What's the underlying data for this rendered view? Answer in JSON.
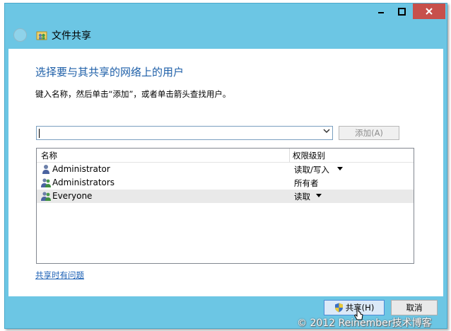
{
  "window": {
    "title": "文件共享",
    "minimize_glyph": "—",
    "maximize_glyph": "▫",
    "close_glyph": "✕"
  },
  "main": {
    "heading": "选择要与其共享的网络上的用户",
    "instruction": "键入名称，然后单击“添加”，或者单击箭头查找用户。",
    "name_input_value": "",
    "add_button": "添加(A)"
  },
  "list": {
    "headers": {
      "name": "名称",
      "permission": "权限级别"
    },
    "rows": [
      {
        "name": "Administrator",
        "permission": "读取/写入",
        "icon": "user-icon",
        "has_dropdown": true
      },
      {
        "name": "Administrators",
        "permission": "所有者",
        "icon": "group-icon",
        "has_dropdown": false
      },
      {
        "name": "Everyone",
        "permission": "读取",
        "icon": "group-icon",
        "has_dropdown": true,
        "selected": true
      }
    ]
  },
  "help_link": "共享时有问题",
  "buttons": {
    "share": "共享(H)",
    "cancel": "取消"
  },
  "watermark": "© 2012 Reinember技术博客",
  "colors": {
    "frame": "#6cc6e4",
    "heading": "#1e5fa8",
    "link": "#1a5fb4",
    "close_button": "#c7504b"
  }
}
